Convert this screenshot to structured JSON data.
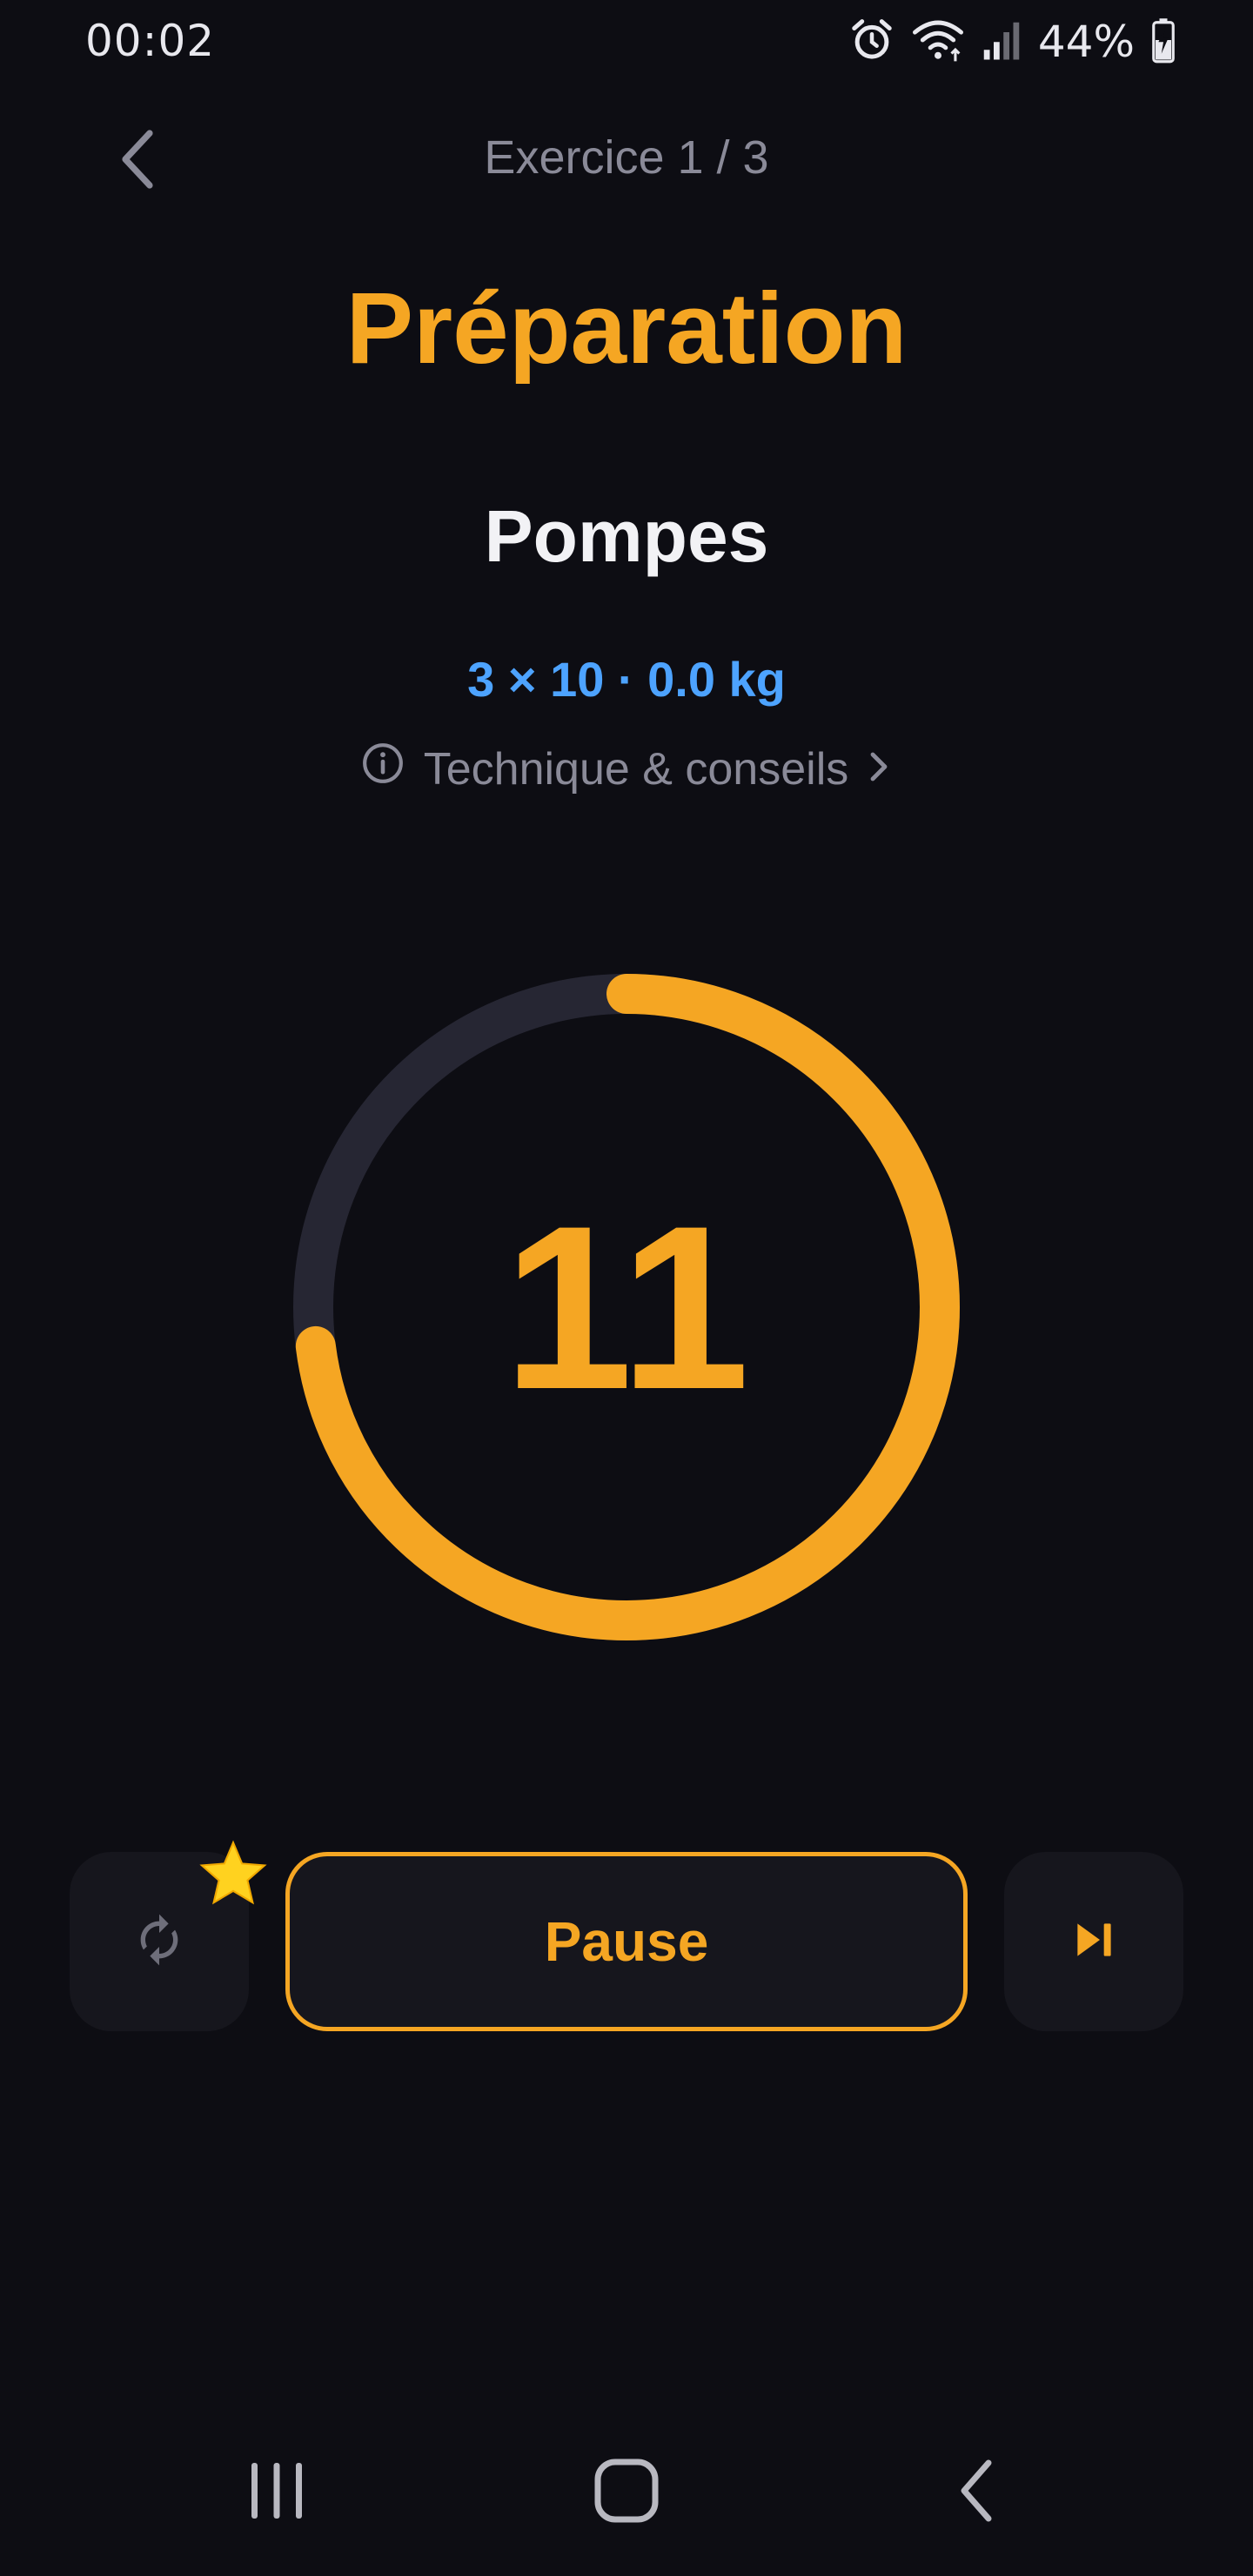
{
  "status_bar": {
    "time": "00:02",
    "battery": "44%"
  },
  "header": {
    "title": "Exercice 1 / 3"
  },
  "phase": {
    "title": "Préparation"
  },
  "exercise": {
    "name": "Pompes",
    "detail": "3 × 10 · 0.0 kg",
    "technique_label": "Technique & conseils"
  },
  "timer": {
    "value": "11",
    "progress": 0.73
  },
  "controls": {
    "pause_label": "Pause"
  },
  "colors": {
    "background": "#0d0d13",
    "accent": "#f5a623",
    "detail": "#4da3ff",
    "muted": "#8a8a98",
    "ring_track": "#262633",
    "button_bg": "#16161d"
  },
  "icons": {
    "back": "chevron-left-icon",
    "info": "info-icon",
    "chevron": "chevron-right-icon",
    "restart": "sync-icon",
    "badge": "star-icon",
    "skip": "skip-next-icon",
    "nav_recents": "recents-icon",
    "nav_home": "home-icon",
    "nav_back": "back-icon"
  }
}
